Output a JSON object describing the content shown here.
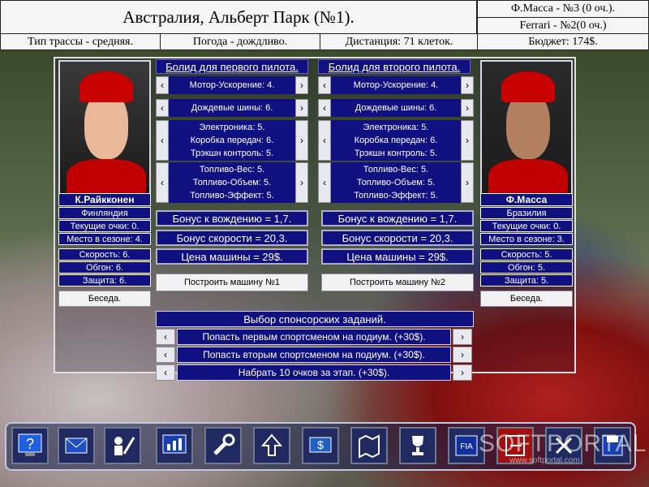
{
  "header": {
    "track_title": "Австралия, Альберт Парк (№1).",
    "driver_line": "Ф.Масса - №3 (0 оч.).",
    "team_line": "Ferrari - №2(0 оч.)",
    "track_type": "Тип трассы - средняя.",
    "weather": "Погода - дождливо.",
    "distance": "Дистанция: 71 клеток.",
    "budget": "Бюджет: 174$."
  },
  "driver1": {
    "name": "К.Райкконен",
    "country": "Финляндия",
    "points": "Текущие очки: 0.",
    "season_place": "Место в сезоне: 4.",
    "speed": "Скорость: 6.",
    "overtake": "Обгон: 6.",
    "defense": "Защита: 6.",
    "talk": "Беседа."
  },
  "driver2": {
    "name": "Ф.Масса",
    "country": "Бразилия",
    "points": "Текущие очки: 0.",
    "season_place": "Место в сезоне: 3.",
    "speed": "Скорость: 5.",
    "overtake": "Обгон: 5.",
    "defense": "Защита: 5.",
    "talk": "Беседа."
  },
  "car1": {
    "header": "Болид для первого пилота.",
    "engine": "Мотор-Ускорение: 4.",
    "tyres": "Дождевые шины: 6.",
    "electronics": [
      "Электроника: 5.",
      "Коробка передач: 6.",
      "Трэкшн контроль: 5."
    ],
    "fuel": [
      "Топливо-Вес: 5.",
      "Топливо-Объем: 5.",
      "Топливо-Эффект: 5."
    ],
    "driving_bonus": "Бонус к вождению = 1,7.",
    "speed_bonus": "Бонус скорости = 20,3.",
    "price": "Цена машины = 29$.",
    "build": "Построить машину №1"
  },
  "car2": {
    "header": "Болид для второго пилота.",
    "engine": "Мотор-Ускорение: 4.",
    "tyres": "Дождевые шины: 6.",
    "electronics": [
      "Электроника: 5.",
      "Коробка передач: 6.",
      "Трэкшн контроль: 5."
    ],
    "fuel": [
      "Топливо-Вес: 5.",
      "Топливо-Объем: 5.",
      "Топливо-Эффект: 5."
    ],
    "driving_bonus": "Бонус к вождению = 1,7.",
    "speed_bonus": "Бонус скорости = 20,3.",
    "price": "Цена машины = 29$.",
    "build": "Построить машину №2"
  },
  "sponsors": {
    "header": "Выбор спонсорских заданий.",
    "tasks": [
      "Попасть первым спортсменом на подиум. (+30$).",
      "Попасть вторым спортсменом на подиум. (+30$).",
      "Набрать 10 очков за этап. (+30$)."
    ]
  },
  "arrows": {
    "left": "‹",
    "right": "›"
  },
  "toolbar_icons": [
    "help-icon",
    "mail-icon",
    "staff-icon",
    "stats-icon",
    "wrench-icon",
    "upgrade-icon",
    "finance-icon",
    "map-icon",
    "trophy-icon",
    "fia-icon",
    "exit-icon",
    "close-icon",
    "save-icon"
  ],
  "watermark": {
    "logo": "SOFTPORTAL",
    "url": "www.softportal.com"
  }
}
